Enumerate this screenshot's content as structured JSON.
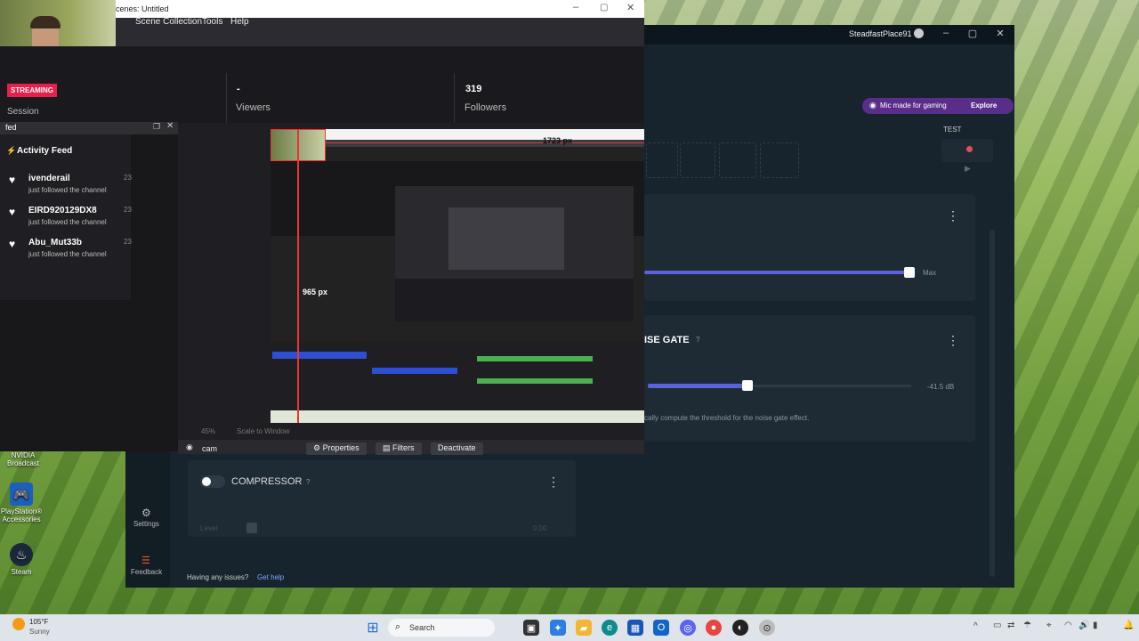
{
  "desktop": {
    "icons": [
      {
        "label": "NVIDIA Broadcast",
        "icon": "nvidia-icon"
      },
      {
        "label": "PlayStation® Accessories",
        "icon": "playstation-icon"
      },
      {
        "label": "Steam",
        "icon": "steam-icon"
      }
    ]
  },
  "obs": {
    "title": "cenes: Untitled",
    "menu": [
      "Scene Collection",
      "Tools",
      "Help"
    ],
    "preview_width": "1723 px",
    "preview_height": "965 px",
    "scale": "45%",
    "scale_mode": "Scale to Window",
    "source_name": "cam",
    "buttons": {
      "properties": "Properties",
      "filters": "Filters",
      "deactivate": "Deactivate"
    }
  },
  "dashboard": {
    "status": "STREAMING",
    "session_label": "Session",
    "viewers_value": "-",
    "viewers_label": "Viewers",
    "followers_value": "319",
    "followers_label": "Followers"
  },
  "feed": {
    "window_title": "fed",
    "title": "Activity Feed",
    "items": [
      {
        "name": "ivenderail",
        "action": "just followed the channel",
        "time": "23"
      },
      {
        "name": "EIRD920129DX8",
        "action": "just followed the channel",
        "time": "23"
      },
      {
        "name": "Abu_Mut33b",
        "action": "just followed the channel",
        "time": "23"
      }
    ]
  },
  "streamlabs": {
    "user": "SteadfastPlace91",
    "promo": "Mic made for gaming",
    "promo_link": "Explore",
    "test_label": "TEST",
    "slider_max": "Max",
    "noise_gate_title": "ISE GATE",
    "noise_gate_help": "?",
    "noise_gate_value": "-41.5 dB",
    "noise_gate_desc": "cally compute the threshold for the noise gate effect.",
    "compressor_title": "COMPRESSOR",
    "compressor_help": "?",
    "level_label": "Level",
    "level_value": "0.00",
    "settings_label": "Settings",
    "feedback_label": "Feedback",
    "issues_text": "Having any issues?",
    "help_link": "Get help"
  },
  "taskbar": {
    "weather_temp": "105°F",
    "weather_desc": "Sunny",
    "search_placeholder": "Search"
  }
}
